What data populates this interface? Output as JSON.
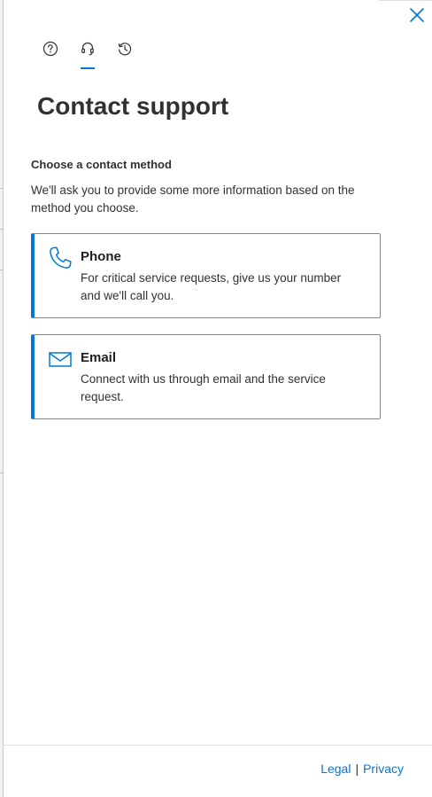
{
  "close": {
    "icon": "close-icon"
  },
  "tabs": [
    {
      "icon": "help-icon",
      "active": false
    },
    {
      "icon": "headset-icon",
      "active": true
    },
    {
      "icon": "history-icon",
      "active": false
    }
  ],
  "title": "Contact support",
  "section": {
    "label": "Choose a contact method",
    "description": "We'll ask you to provide some more information based on the method you choose."
  },
  "methods": [
    {
      "icon": "phone-icon",
      "title": "Phone",
      "description": "For critical service requests, give us your number and we'll call you."
    },
    {
      "icon": "mail-icon",
      "title": "Email",
      "description": "Connect with us through email and the service request."
    }
  ],
  "footer": {
    "legal": "Legal",
    "separator": "|",
    "privacy": "Privacy"
  },
  "colors": {
    "accent": "#0078d4",
    "text": "#323130",
    "border": "#8a8886"
  }
}
